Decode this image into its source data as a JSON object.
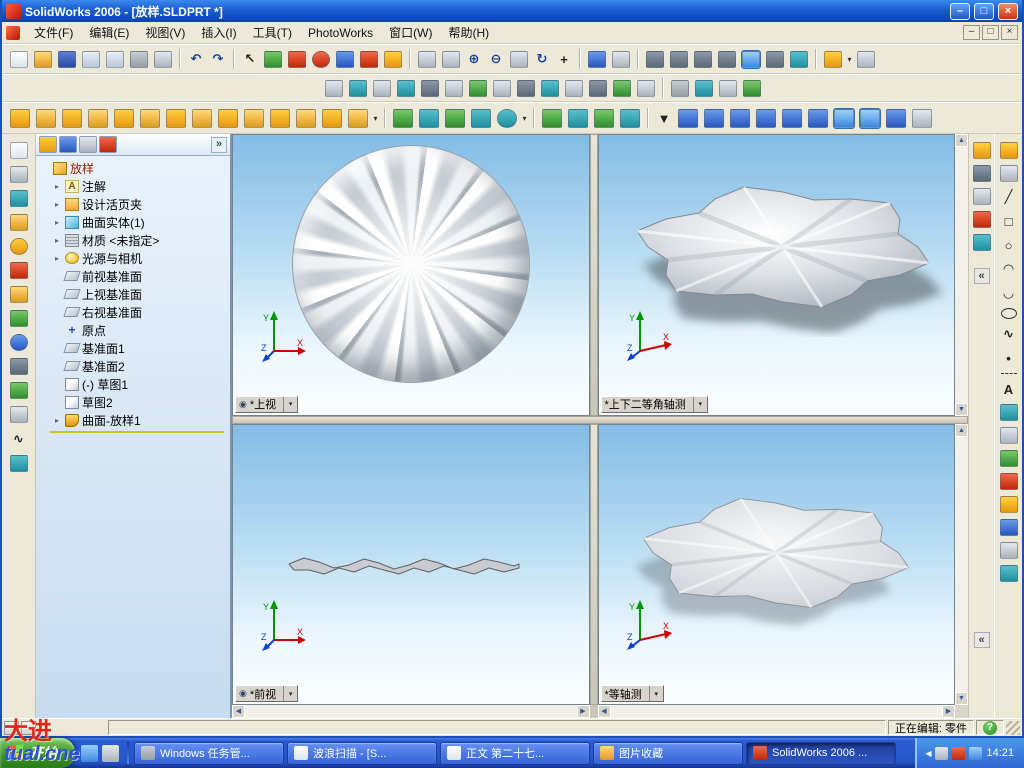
{
  "window": {
    "title": "SolidWorks 2006 - [放样.SLDPRT *]"
  },
  "menu": {
    "items": [
      "文件(F)",
      "编辑(E)",
      "视图(V)",
      "插入(I)",
      "工具(T)",
      "PhotoWorks",
      "窗口(W)",
      "帮助(H)"
    ]
  },
  "tree": {
    "root": "放样",
    "items": [
      {
        "label": "注解"
      },
      {
        "label": "设计活页夹"
      },
      {
        "label": "曲面实体(1)"
      },
      {
        "label": "材质 <未指定>"
      },
      {
        "label": "光源与相机"
      },
      {
        "label": "前视基准面"
      },
      {
        "label": "上视基准面"
      },
      {
        "label": "右视基准面"
      },
      {
        "label": "原点"
      },
      {
        "label": "基准面1"
      },
      {
        "label": "基准面2"
      },
      {
        "label": "(-) 草图1"
      },
      {
        "label": "草图2"
      },
      {
        "label": "曲面-放样1"
      }
    ]
  },
  "viewports": {
    "top_left": {
      "label": "*上视"
    },
    "top_right": {
      "label": "*上下二等角轴测"
    },
    "bottom_left": {
      "label": "*前视"
    },
    "bottom_right": {
      "label": "*等轴测"
    },
    "axis": {
      "x": "X",
      "y": "Y",
      "z": "Z"
    }
  },
  "status": {
    "editing": "正在编辑: 零件"
  },
  "taskbar": {
    "start": "开始",
    "time": "14:21",
    "tasks": [
      {
        "label": "Windows 任务管..."
      },
      {
        "label": "波浪扫描 - [S..."
      },
      {
        "label": "正文 第二十七..."
      },
      {
        "label": "图片收藏"
      },
      {
        "label": "SolidWorks 2006 ..."
      }
    ]
  },
  "watermark": {
    "line1": "大进",
    "line2": "tual.cne"
  },
  "icons": {
    "dd": "▾",
    "chevron": "»",
    "collapse": "«",
    "up": "▲",
    "down": "▼",
    "left": "◀",
    "right": "▶",
    "undo": "↶",
    "redo": "↷",
    "rotate": "↻",
    "select": "↖",
    "zoom_in": "⊕",
    "zoom_out": "⊖",
    "min": "–",
    "restore": "□",
    "close": "×",
    "help": "?",
    "eye": "◉",
    "expander": "▸",
    "line": "╱",
    "rect": "□",
    "circle": "○",
    "arc": "◠",
    "arc2": "◡",
    "spline": "∿",
    "point": "•",
    "text_a": "A",
    "plus": "+"
  }
}
